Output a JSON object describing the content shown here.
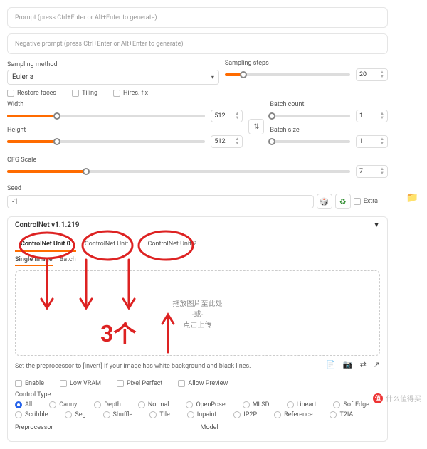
{
  "prompt": {
    "placeholder": "Prompt (press Ctrl+Enter or Alt+Enter to generate)"
  },
  "neg_prompt": {
    "placeholder": "Negative prompt (press Ctrl+Enter or Alt+Enter to generate)"
  },
  "sampling": {
    "method_label": "Sampling method",
    "method_value": "Euler a",
    "steps_label": "Sampling steps",
    "steps_value": "20"
  },
  "checks": {
    "restore": "Restore faces",
    "tiling": "Tiling",
    "hires": "Hires. fix"
  },
  "dims": {
    "width_label": "Width",
    "width_value": "512",
    "height_label": "Height",
    "height_value": "512"
  },
  "batch": {
    "count_label": "Batch count",
    "count_value": "1",
    "size_label": "Batch size",
    "size_value": "1"
  },
  "cfg": {
    "label": "CFG Scale",
    "value": "7"
  },
  "seed": {
    "label": "Seed",
    "value": "-1",
    "dice": "🎲",
    "recycle": "♻",
    "extra": "Extra"
  },
  "controlnet": {
    "title": "ControlNet v1.1.219",
    "tabs": [
      "ControlNet Unit 0",
      "ControlNet Unit 1",
      "ControlNet Unit 2"
    ],
    "subtabs": [
      "Single Image",
      "Batch"
    ],
    "drop_l1": "拖放图片至此处",
    "drop_or": "-或-",
    "drop_l2": "点击上传",
    "invert_hint": "Set the preprocessor to [invert] If your image has white background and black lines.",
    "opts": {
      "enable": "Enable",
      "lowvram": "Low VRAM",
      "pixel": "Pixel Perfect",
      "preview": "Allow Preview"
    },
    "ctype_label": "Control Type",
    "ctypes": [
      "All",
      "Canny",
      "Depth",
      "Normal",
      "OpenPose",
      "MLSD",
      "Lineart",
      "SoftEdge",
      "Scribble",
      "Seg",
      "Shuffle",
      "Tile",
      "Inpaint",
      "IP2P",
      "Reference",
      "T2IA"
    ],
    "preproc_label": "Preprocessor",
    "model_label": "Model"
  },
  "annotation": "3个",
  "watermark": "什么值得买"
}
